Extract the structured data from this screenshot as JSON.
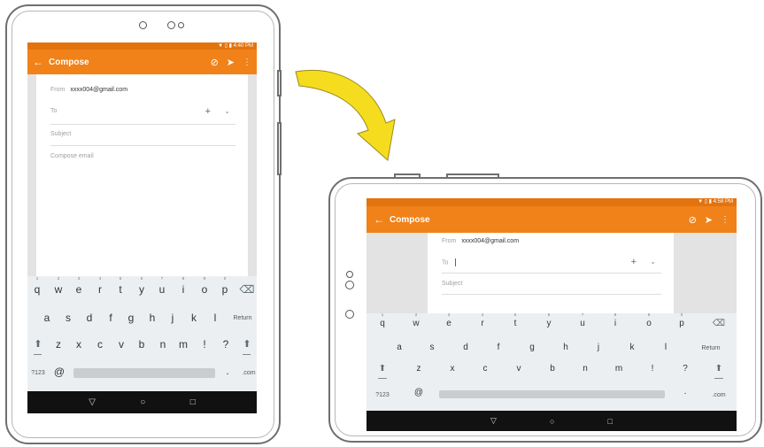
{
  "status": {
    "portrait_time": "4:40 PM",
    "landscape_time": "4:58 PM"
  },
  "app": {
    "title": "Compose",
    "icons": {
      "back": "arrow-back-icon",
      "attach": "attachment-icon",
      "send": "send-icon",
      "menu": "overflow-menu-icon"
    }
  },
  "compose": {
    "from_label": "From",
    "from_value": "xxxx004@gmail.com",
    "to_label": "To",
    "subject_placeholder": "Subject",
    "body_placeholder": "Compose email"
  },
  "keyboard": {
    "row1": [
      {
        "k": "q",
        "h": "1"
      },
      {
        "k": "w",
        "h": "2"
      },
      {
        "k": "e",
        "h": "3"
      },
      {
        "k": "r",
        "h": "4"
      },
      {
        "k": "t",
        "h": "5"
      },
      {
        "k": "y",
        "h": "6"
      },
      {
        "k": "u",
        "h": "7"
      },
      {
        "k": "i",
        "h": "8"
      },
      {
        "k": "o",
        "h": "9"
      },
      {
        "k": "p",
        "h": "0"
      }
    ],
    "row2": [
      "a",
      "s",
      "d",
      "f",
      "g",
      "h",
      "j",
      "k",
      "l"
    ],
    "row3_portrait": [
      "z",
      "x",
      "c",
      "v",
      "b",
      "n",
      "m",
      "!",
      "?"
    ],
    "row3_landscape": [
      "z",
      "x",
      "c",
      "v",
      "b",
      "n",
      "m",
      "!",
      "?"
    ],
    "return_label": "Return",
    "symbols_label": "?123",
    "at_label": "@",
    "period_label": ".",
    "com_label": ".com",
    "backspace_icon": "backspace-icon",
    "shift_icon": "shift-icon"
  },
  "navigation": {
    "back": "▽",
    "home": "○",
    "recents": "□"
  }
}
